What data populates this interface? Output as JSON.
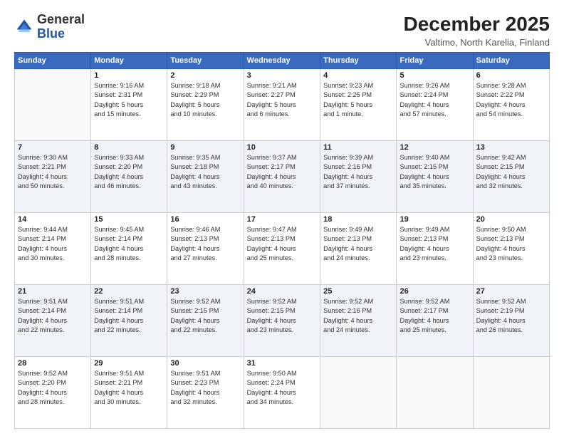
{
  "header": {
    "logo_general": "General",
    "logo_blue": "Blue",
    "month_year": "December 2025",
    "location": "Valtimo, North Karelia, Finland"
  },
  "weekdays": [
    "Sunday",
    "Monday",
    "Tuesday",
    "Wednesday",
    "Thursday",
    "Friday",
    "Saturday"
  ],
  "weeks": [
    [
      {
        "day": "",
        "info": ""
      },
      {
        "day": "1",
        "info": "Sunrise: 9:16 AM\nSunset: 2:31 PM\nDaylight: 5 hours\nand 15 minutes."
      },
      {
        "day": "2",
        "info": "Sunrise: 9:18 AM\nSunset: 2:29 PM\nDaylight: 5 hours\nand 10 minutes."
      },
      {
        "day": "3",
        "info": "Sunrise: 9:21 AM\nSunset: 2:27 PM\nDaylight: 5 hours\nand 6 minutes."
      },
      {
        "day": "4",
        "info": "Sunrise: 9:23 AM\nSunset: 2:25 PM\nDaylight: 5 hours\nand 1 minute."
      },
      {
        "day": "5",
        "info": "Sunrise: 9:26 AM\nSunset: 2:24 PM\nDaylight: 4 hours\nand 57 minutes."
      },
      {
        "day": "6",
        "info": "Sunrise: 9:28 AM\nSunset: 2:22 PM\nDaylight: 4 hours\nand 54 minutes."
      }
    ],
    [
      {
        "day": "7",
        "info": "Sunrise: 9:30 AM\nSunset: 2:21 PM\nDaylight: 4 hours\nand 50 minutes."
      },
      {
        "day": "8",
        "info": "Sunrise: 9:33 AM\nSunset: 2:20 PM\nDaylight: 4 hours\nand 46 minutes."
      },
      {
        "day": "9",
        "info": "Sunrise: 9:35 AM\nSunset: 2:18 PM\nDaylight: 4 hours\nand 43 minutes."
      },
      {
        "day": "10",
        "info": "Sunrise: 9:37 AM\nSunset: 2:17 PM\nDaylight: 4 hours\nand 40 minutes."
      },
      {
        "day": "11",
        "info": "Sunrise: 9:39 AM\nSunset: 2:16 PM\nDaylight: 4 hours\nand 37 minutes."
      },
      {
        "day": "12",
        "info": "Sunrise: 9:40 AM\nSunset: 2:15 PM\nDaylight: 4 hours\nand 35 minutes."
      },
      {
        "day": "13",
        "info": "Sunrise: 9:42 AM\nSunset: 2:15 PM\nDaylight: 4 hours\nand 32 minutes."
      }
    ],
    [
      {
        "day": "14",
        "info": "Sunrise: 9:44 AM\nSunset: 2:14 PM\nDaylight: 4 hours\nand 30 minutes."
      },
      {
        "day": "15",
        "info": "Sunrise: 9:45 AM\nSunset: 2:14 PM\nDaylight: 4 hours\nand 28 minutes."
      },
      {
        "day": "16",
        "info": "Sunrise: 9:46 AM\nSunset: 2:13 PM\nDaylight: 4 hours\nand 27 minutes."
      },
      {
        "day": "17",
        "info": "Sunrise: 9:47 AM\nSunset: 2:13 PM\nDaylight: 4 hours\nand 25 minutes."
      },
      {
        "day": "18",
        "info": "Sunrise: 9:49 AM\nSunset: 2:13 PM\nDaylight: 4 hours\nand 24 minutes."
      },
      {
        "day": "19",
        "info": "Sunrise: 9:49 AM\nSunset: 2:13 PM\nDaylight: 4 hours\nand 23 minutes."
      },
      {
        "day": "20",
        "info": "Sunrise: 9:50 AM\nSunset: 2:13 PM\nDaylight: 4 hours\nand 23 minutes."
      }
    ],
    [
      {
        "day": "21",
        "info": "Sunrise: 9:51 AM\nSunset: 2:14 PM\nDaylight: 4 hours\nand 22 minutes."
      },
      {
        "day": "22",
        "info": "Sunrise: 9:51 AM\nSunset: 2:14 PM\nDaylight: 4 hours\nand 22 minutes."
      },
      {
        "day": "23",
        "info": "Sunrise: 9:52 AM\nSunset: 2:15 PM\nDaylight: 4 hours\nand 22 minutes."
      },
      {
        "day": "24",
        "info": "Sunrise: 9:52 AM\nSunset: 2:15 PM\nDaylight: 4 hours\nand 23 minutes."
      },
      {
        "day": "25",
        "info": "Sunrise: 9:52 AM\nSunset: 2:16 PM\nDaylight: 4 hours\nand 24 minutes."
      },
      {
        "day": "26",
        "info": "Sunrise: 9:52 AM\nSunset: 2:17 PM\nDaylight: 4 hours\nand 25 minutes."
      },
      {
        "day": "27",
        "info": "Sunrise: 9:52 AM\nSunset: 2:19 PM\nDaylight: 4 hours\nand 26 minutes."
      }
    ],
    [
      {
        "day": "28",
        "info": "Sunrise: 9:52 AM\nSunset: 2:20 PM\nDaylight: 4 hours\nand 28 minutes."
      },
      {
        "day": "29",
        "info": "Sunrise: 9:51 AM\nSunset: 2:21 PM\nDaylight: 4 hours\nand 30 minutes."
      },
      {
        "day": "30",
        "info": "Sunrise: 9:51 AM\nSunset: 2:23 PM\nDaylight: 4 hours\nand 32 minutes."
      },
      {
        "day": "31",
        "info": "Sunrise: 9:50 AM\nSunset: 2:24 PM\nDaylight: 4 hours\nand 34 minutes."
      },
      {
        "day": "",
        "info": ""
      },
      {
        "day": "",
        "info": ""
      },
      {
        "day": "",
        "info": ""
      }
    ]
  ]
}
